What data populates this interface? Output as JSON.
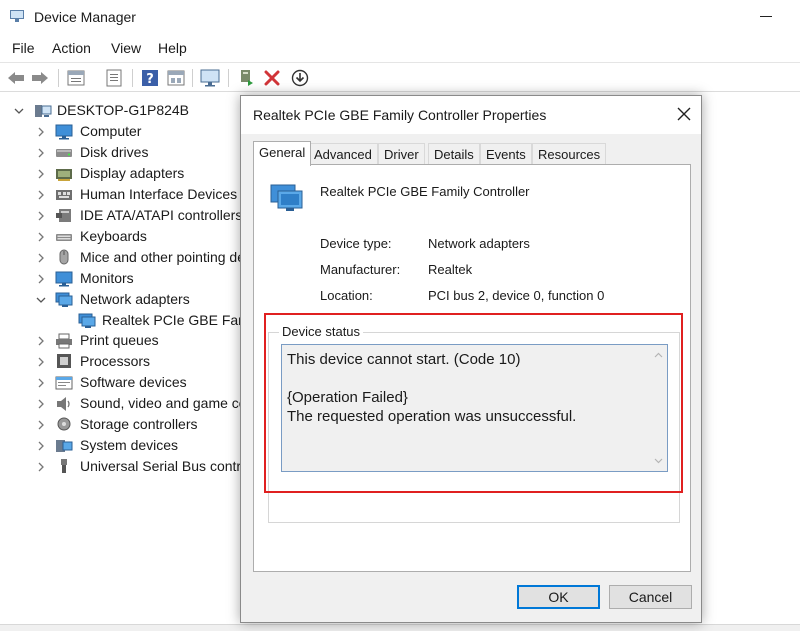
{
  "window": {
    "title": "Device Manager"
  },
  "menu": [
    "File",
    "Action",
    "View",
    "Help"
  ],
  "toolbar": {
    "buttons": [
      "back-icon",
      "forward-icon",
      "properties-icon",
      "print-icon",
      "help-icon",
      "view-icon",
      "monitor-icon",
      "update-driver-icon",
      "uninstall-icon",
      "download-icon"
    ]
  },
  "tree": {
    "root": "DESKTOP-G1P824B",
    "items": [
      {
        "label": "Computer",
        "expanded": false
      },
      {
        "label": "Disk drives",
        "expanded": false
      },
      {
        "label": "Display adapters",
        "expanded": false
      },
      {
        "label": "Human Interface Devices",
        "expanded": false
      },
      {
        "label": "IDE ATA/ATAPI controllers",
        "expanded": false
      },
      {
        "label": "Keyboards",
        "expanded": false
      },
      {
        "label": "Mice and other pointing de",
        "expanded": false
      },
      {
        "label": "Monitors",
        "expanded": false
      },
      {
        "label": "Network adapters",
        "expanded": true
      },
      {
        "label": "Realtek PCIe GBE Famil",
        "child": true
      },
      {
        "label": "Print queues",
        "expanded": false
      },
      {
        "label": "Processors",
        "expanded": false
      },
      {
        "label": "Software devices",
        "expanded": false
      },
      {
        "label": "Sound, video and game co",
        "expanded": false
      },
      {
        "label": "Storage controllers",
        "expanded": false
      },
      {
        "label": "System devices",
        "expanded": false
      },
      {
        "label": "Universal Serial Bus contro",
        "expanded": false
      }
    ]
  },
  "dialog": {
    "title": "Realtek PCIe GBE Family Controller Properties",
    "tabs": [
      "General",
      "Advanced",
      "Driver",
      "Details",
      "Events",
      "Resources"
    ],
    "active_tab": "General",
    "device_name": "Realtek PCIe GBE Family Controller",
    "properties": [
      {
        "label": "Device type:",
        "value": "Network adapters"
      },
      {
        "label": "Manufacturer:",
        "value": "Realtek"
      },
      {
        "label": "Location:",
        "value": "PCI bus 2, device 0, function 0"
      }
    ],
    "status_label": "Device status",
    "status_lines": [
      "This device cannot start. (Code 10)",
      "",
      "{Operation Failed}",
      "The requested operation was unsuccessful."
    ],
    "ok_label": "OK",
    "cancel_label": "Cancel"
  },
  "colors": {
    "highlight": "#e02020",
    "focus": "#0078d7",
    "uninstall_red": "#d13438"
  }
}
